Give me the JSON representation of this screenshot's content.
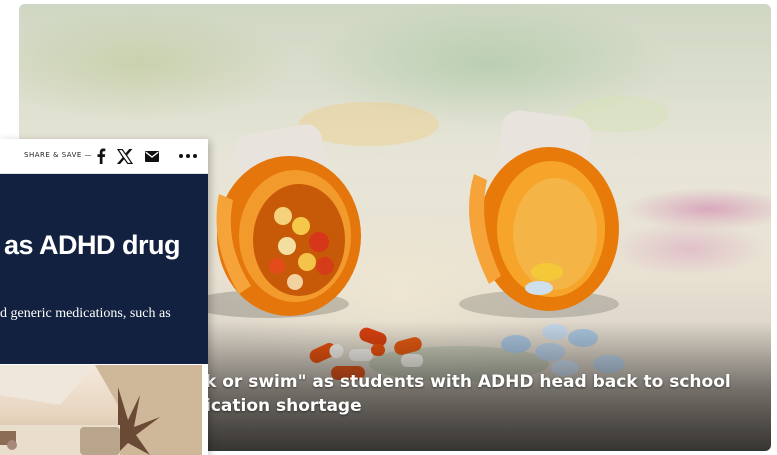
{
  "hero": {
    "caption_line1": "k or swim\" as students with ADHD head back to school",
    "caption_line2": "ication shortage",
    "image_subject": "pill-bottles-photo"
  },
  "article": {
    "share_label": "SHARE & SAVE —",
    "icons": {
      "facebook": "facebook-icon",
      "x": "x-icon",
      "mail": "mail-icon",
      "more": "more-icon"
    },
    "headline": "as ADHD drug",
    "dek": "d generic medications, such as",
    "thumbnail_subject": "room-photo"
  },
  "colors": {
    "navy": "#12213f",
    "pill_orange": "#f08a12"
  }
}
